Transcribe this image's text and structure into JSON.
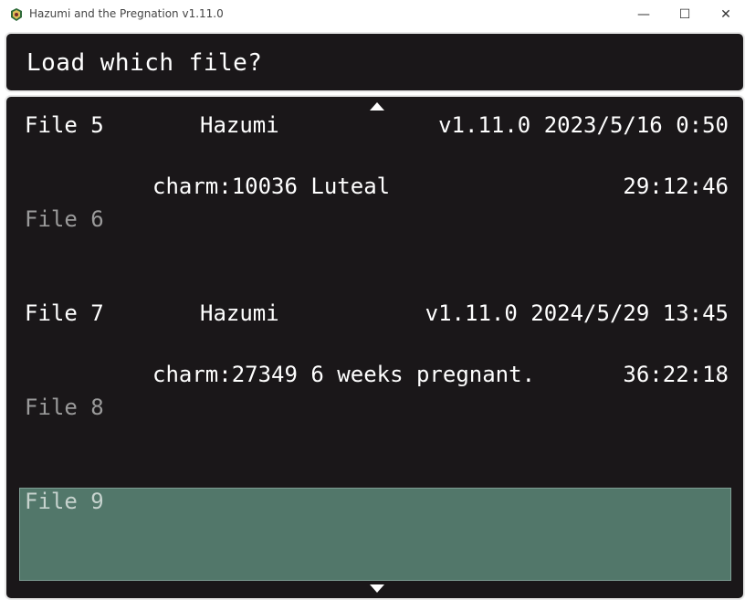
{
  "window": {
    "title": "Hazumi and the Pregnation v1.11.0",
    "icon": "app-icon",
    "controls": {
      "minimize": "—",
      "maximize": "☐",
      "close": "✕"
    }
  },
  "header": {
    "prompt": "Load which file?"
  },
  "slots": [
    {
      "label": "File 5",
      "name": "Hazumi",
      "version_date": "v1.11.0 2023/5/16 0:50",
      "status": "charm:10036 Luteal",
      "playtime": "29:12:46"
    },
    {
      "label": "File 6"
    },
    {
      "label": "File 7",
      "name": "Hazumi",
      "version_date": "v1.11.0 2024/5/29 13:45",
      "status": "charm:27349 6 weeks pregnant.",
      "playtime": "36:22:18"
    },
    {
      "label": "File 8"
    },
    {
      "label": "File 9",
      "selected": true
    }
  ],
  "colors": {
    "panel_bg": "#1a1719",
    "panel_border": "#e9e9e9",
    "selected_bg": "#52776a",
    "empty_text": "#9a9a9a"
  }
}
